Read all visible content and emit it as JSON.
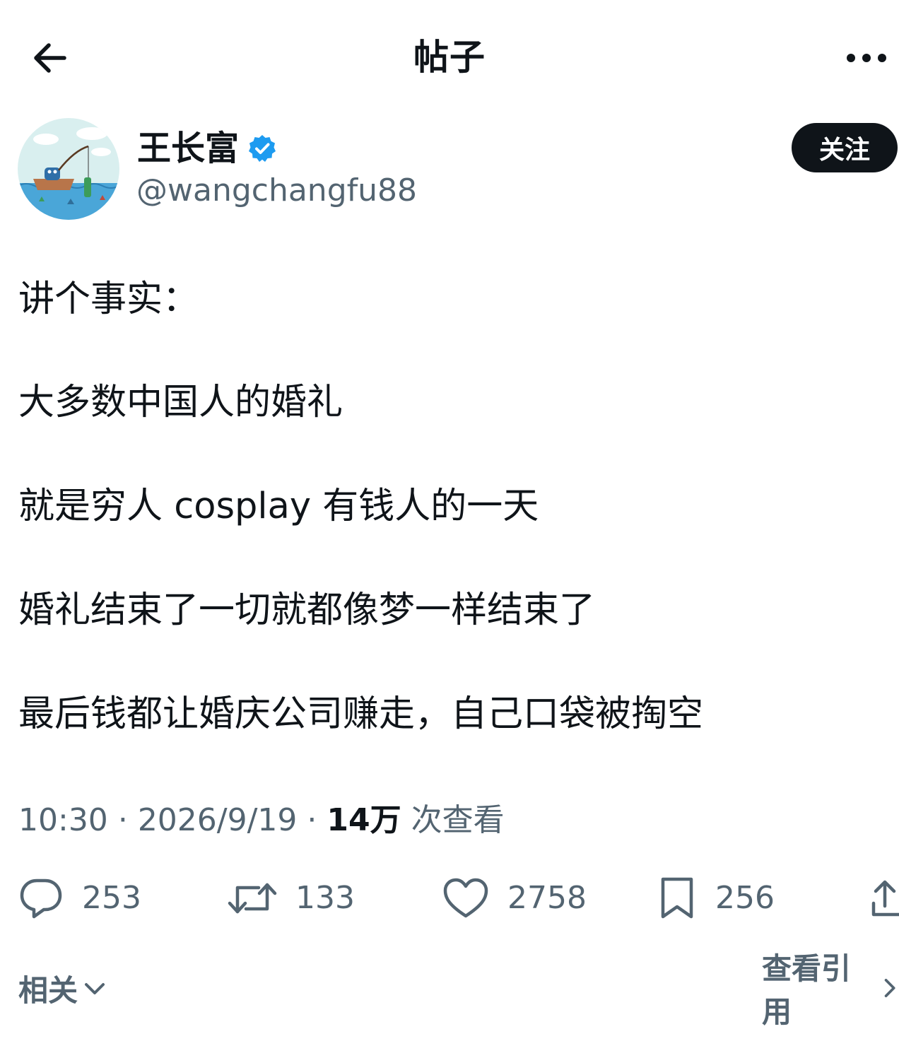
{
  "header": {
    "title": "帖子"
  },
  "author": {
    "display_name": "王长富",
    "handle": "@wangchangfu88",
    "follow_label": "关注"
  },
  "post": {
    "lines": [
      "讲个事实：",
      "大多数中国人的婚礼",
      "就是穷人 cosplay 有钱人的一天",
      "婚礼结束了一切就都像梦一样结束了",
      "最后钱都让婚庆公司赚走，自己口袋被掏空"
    ]
  },
  "meta": {
    "time": "10:30",
    "date": "2026/9/19",
    "views_count": "14万",
    "views_label": "次查看",
    "separator": "·"
  },
  "actions": {
    "replies": "253",
    "reposts": "133",
    "likes": "2758",
    "bookmarks": "256"
  },
  "footer": {
    "related_label": "相关",
    "quotes_label": "查看引用"
  },
  "colors": {
    "text_primary": "#0f1419",
    "text_secondary": "#536471",
    "verified_blue": "#1d9bf0",
    "button_dark": "#0f1419"
  },
  "icons": {
    "back": "arrow-left-icon",
    "more": "more-horizontal-icon",
    "verified": "verified-badge-icon",
    "reply": "reply-icon",
    "repost": "repost-icon",
    "like": "heart-icon",
    "bookmark": "bookmark-icon",
    "share": "share-icon",
    "related_chevron": "chevron-down-icon",
    "quotes_chevron": "chevron-right-icon"
  }
}
